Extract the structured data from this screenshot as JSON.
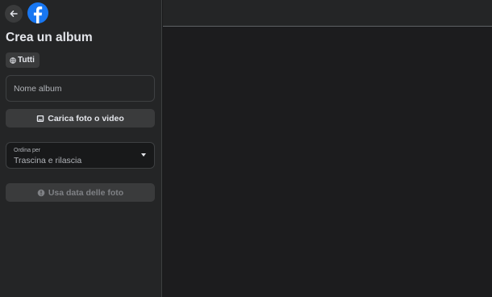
{
  "icons": {
    "back": "back-arrow-icon",
    "logo": "facebook-logo-icon",
    "privacy": "globe-icon",
    "upload": "add-photo-icon",
    "sort": "caret-down-icon",
    "date": "info-icon"
  },
  "colors": {
    "brand": "#1877f2",
    "panel": "#242526",
    "canvas": "#1c1c1e"
  },
  "sidebar": {
    "title": "Crea un album",
    "privacy_label": "Tutti",
    "album_name_placeholder": "Nome album",
    "upload_label": "Carica foto o video",
    "sort": {
      "label": "Ordina per",
      "value": "Trascina e rilascia"
    },
    "use_date_label": "Usa data delle foto"
  }
}
